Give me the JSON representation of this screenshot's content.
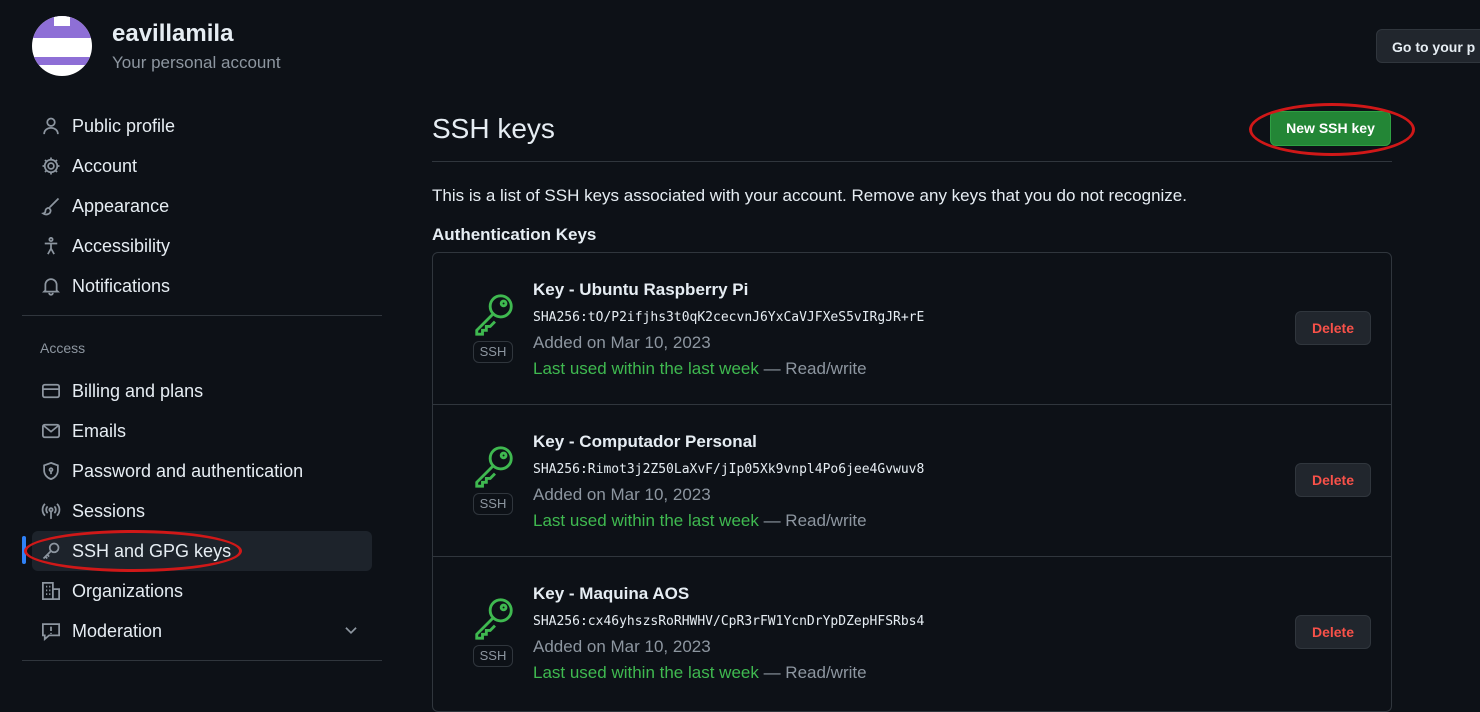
{
  "header": {
    "username": "eavillamila",
    "subtitle": "Your personal account",
    "goto_button": "Go to your p"
  },
  "sidebar": {
    "items": [
      {
        "label": "Public profile",
        "icon": "person-icon"
      },
      {
        "label": "Account",
        "icon": "gear-icon"
      },
      {
        "label": "Appearance",
        "icon": "paintbrush-icon"
      },
      {
        "label": "Accessibility",
        "icon": "accessibility-icon"
      },
      {
        "label": "Notifications",
        "icon": "bell-icon"
      }
    ],
    "access_label": "Access",
    "access_items": [
      {
        "label": "Billing and plans",
        "icon": "credit-card-icon"
      },
      {
        "label": "Emails",
        "icon": "mail-icon"
      },
      {
        "label": "Password and authentication",
        "icon": "shield-lock-icon"
      },
      {
        "label": "Sessions",
        "icon": "broadcast-icon"
      },
      {
        "label": "SSH and GPG keys",
        "icon": "key-icon",
        "active": true
      },
      {
        "label": "Organizations",
        "icon": "organization-icon"
      },
      {
        "label": "Moderation",
        "icon": "report-icon"
      }
    ]
  },
  "main": {
    "title": "SSH keys",
    "new_key_button": "New SSH key",
    "description": "This is a list of SSH keys associated with your account. Remove any keys that you do not recognize.",
    "auth_heading": "Authentication Keys",
    "badge": "SSH",
    "delete_label": "Delete",
    "keys": [
      {
        "title": "Key - Ubuntu Raspberry Pi",
        "fingerprint": "SHA256:tO/P2ifjhs3t0qK2cecvnJ6YxCaVJFXeS5vIRgJR+rE",
        "added": "Added on Mar 10, 2023",
        "last_used": "Last used within the last week",
        "access": " — Read/write"
      },
      {
        "title": "Key - Computador Personal",
        "fingerprint": "SHA256:Rimot3j2Z50LaXvF/jIp05Xk9vnpl4Po6jee4Gvwuv8",
        "added": "Added on Mar 10, 2023",
        "last_used": "Last used within the last week",
        "access": " — Read/write"
      },
      {
        "title": "Key - Maquina AOS",
        "fingerprint": "SHA256:cx46yhszsRoRHWHV/CpR3rFW1YcnDrYpDZepHFSRbs4",
        "added": "Added on Mar 10, 2023",
        "last_used": "Last used within the last week",
        "access": " — Read/write"
      }
    ]
  },
  "colors": {
    "background": "#0d1117",
    "primary_button": "#238636",
    "danger_text": "#f85149",
    "success_text": "#3fb950",
    "annotation": "#d01818"
  }
}
